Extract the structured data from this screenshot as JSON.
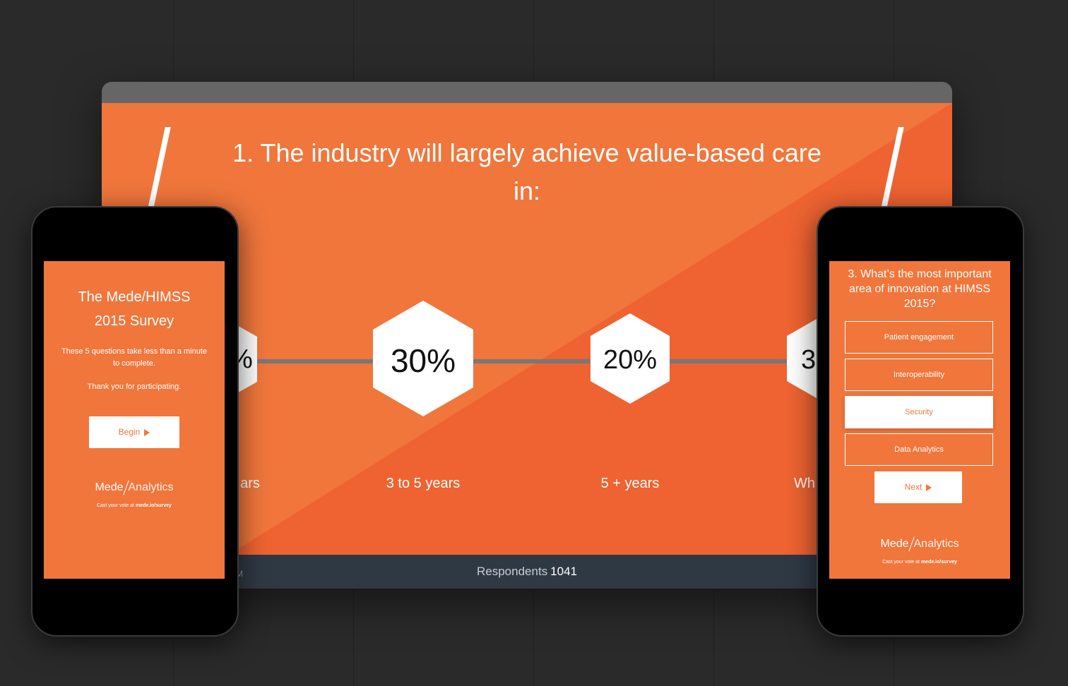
{
  "colors": {
    "accent": "#f0763c",
    "accent_dark": "#ee5f2e",
    "bar": "#2f3944",
    "background": "#2a2a2a"
  },
  "desktop": {
    "question": "1. The industry will largely achieve value-based care in:",
    "options": [
      {
        "value": "%",
        "label": "ars"
      },
      {
        "value": "30%",
        "label": "3 to 5 years"
      },
      {
        "value": "20%",
        "label": "5 + years"
      },
      {
        "value": "3",
        "label": "Wh"
      }
    ],
    "footer_left": "M",
    "respondents_label": "Respondents",
    "respondents_count": "1041"
  },
  "phone_left": {
    "title_line1": "The Mede/HIMSS",
    "title_line2": "2015 Survey",
    "intro_line1": "These 5 questions take less than a minute",
    "intro_line2": "to complete.",
    "thanks": "Thank you for participating.",
    "begin_label": "Begin",
    "brand_left": "Mede",
    "brand_right": "Analytics",
    "tagline_prefix": "Cast your vote at",
    "tagline_url": "mede.io/survey"
  },
  "phone_right": {
    "question_line1": "3. What’s the most important",
    "question_line2": "area of innovation at HIMSS",
    "question_line3": "2015?",
    "choices": [
      "Patient engagement",
      "Interoperability",
      "Security",
      "Data Analytics"
    ],
    "selected": "Security",
    "next_label": "Next",
    "brand_left": "Mede",
    "brand_right": "Analytics",
    "tagline_prefix": "Cast your vote at",
    "tagline_url": "mede.io/survey"
  }
}
